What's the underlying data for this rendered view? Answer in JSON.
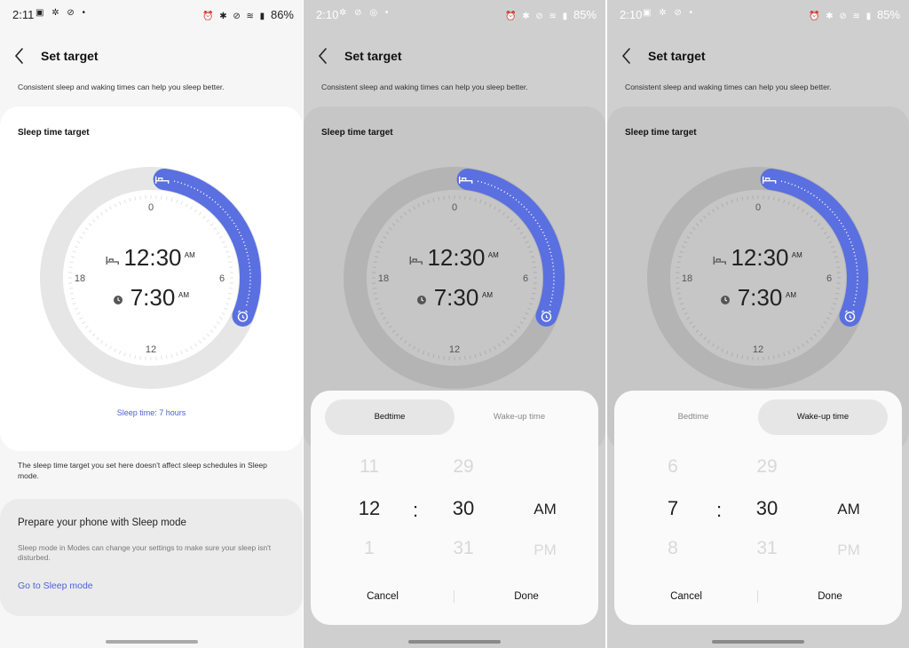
{
  "screens": [
    {
      "status": {
        "time": "2:11",
        "left_icons": "▣ ✲ ⊘ •",
        "right_icons": "⏰ ✱ ⊘ ≋ ▮",
        "battery": "86%"
      },
      "header": {
        "title": "Set target"
      },
      "subtitle": "Consistent sleep and waking times can help you sleep better.",
      "card": {
        "title": "Sleep time target",
        "clock": {
          "ticks": [
            "0",
            "6",
            "12",
            "18"
          ],
          "bedtime": "12:30",
          "bedtime_ampm": "AM",
          "wake": "7:30",
          "wake_ampm": "AM"
        },
        "sleep_time": "Sleep time: 7 hours"
      },
      "note": "The sleep time target you set here doesn't affect sleep schedules in Sleep mode.",
      "prepare": {
        "title": "Prepare your phone with Sleep mode",
        "description": "Sleep mode in Modes can change your settings to make sure your sleep isn't disturbed.",
        "link": "Go to Sleep mode"
      }
    },
    {
      "status": {
        "time": "2:10",
        "left_icons": "✲ ⊘ ◎ •",
        "right_icons": "⏰ ✱ ⊘ ≋ ▮",
        "battery": "85%"
      },
      "header": {
        "title": "Set target"
      },
      "subtitle": "Consistent sleep and waking times can help you sleep better.",
      "card": {
        "title": "Sleep time target",
        "clock": {
          "ticks": [
            "0",
            "6",
            "12",
            "18"
          ],
          "bedtime": "12:30",
          "bedtime_ampm": "AM",
          "wake": "7:30",
          "wake_ampm": "AM"
        }
      },
      "sheet": {
        "tabs": [
          "Bedtime",
          "Wake-up time"
        ],
        "selected_tab": "Bedtime",
        "hour": {
          "prev": "11",
          "value": "12",
          "next": "1"
        },
        "minute": {
          "prev": "29",
          "value": "30",
          "next": "31"
        },
        "ampm": {
          "value": "AM",
          "other": "PM"
        },
        "colon": ":",
        "cancel": "Cancel",
        "done": "Done"
      }
    },
    {
      "status": {
        "time": "2:10",
        "left_icons": "▣ ✲ ⊘ •",
        "right_icons": "⏰ ✱ ⊘ ≋ ▮",
        "battery": "85%"
      },
      "header": {
        "title": "Set target"
      },
      "subtitle": "Consistent sleep and waking times can help you sleep better.",
      "card": {
        "title": "Sleep time target",
        "clock": {
          "ticks": [
            "0",
            "6",
            "12",
            "18"
          ],
          "bedtime": "12:30",
          "bedtime_ampm": "AM",
          "wake": "7:30",
          "wake_ampm": "AM"
        }
      },
      "sheet": {
        "tabs": [
          "Bedtime",
          "Wake-up time"
        ],
        "selected_tab": "Wake-up time",
        "hour": {
          "prev": "6",
          "value": "7",
          "next": "8"
        },
        "minute": {
          "prev": "29",
          "value": "30",
          "next": "31"
        },
        "ampm": {
          "value": "AM",
          "other": "PM"
        },
        "colon": ":",
        "cancel": "Cancel",
        "done": "Done"
      }
    }
  ],
  "colors": {
    "accent": "#4a62d8",
    "arc": "#5a6fe0",
    "ring": "#e6e6e6",
    "ring_dim": "#b4b4b4"
  }
}
